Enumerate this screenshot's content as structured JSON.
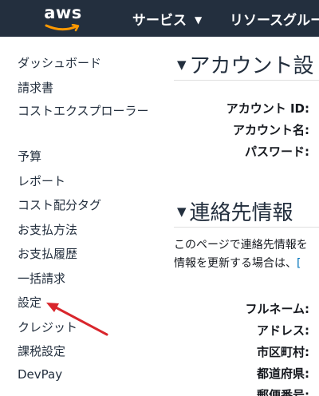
{
  "topnav": {
    "logo_text": "aws",
    "services_label": "サービス",
    "resource_groups_label": "リソースグルー"
  },
  "sidebar": {
    "items": [
      {
        "label": "ダッシュボード"
      },
      {
        "label": "請求書"
      },
      {
        "label": "コストエクスプローラー"
      },
      {
        "label": "予算"
      },
      {
        "label": "レポート"
      },
      {
        "label": "コスト配分タグ"
      },
      {
        "label": "お支払方法"
      },
      {
        "label": "お支払履歴"
      },
      {
        "label": "一括請求"
      },
      {
        "label": "設定"
      },
      {
        "label": "クレジット"
      },
      {
        "label": "課税設定"
      },
      {
        "label": "DevPay"
      }
    ]
  },
  "account_section": {
    "title": "アカウント設",
    "fields": [
      {
        "label": "アカウント ID:"
      },
      {
        "label": "アカウント名:"
      },
      {
        "label": "パスワード:"
      }
    ]
  },
  "contact_section": {
    "title": "連絡先情報",
    "desc_line1": "このページで連絡先情報を",
    "desc_line2": "情報を更新する場合は、",
    "desc_link": "[",
    "fields": [
      {
        "label": "フルネーム:"
      },
      {
        "label": "アドレス:"
      },
      {
        "label": "市区町村:"
      },
      {
        "label": "都道府県:"
      },
      {
        "label": "郵便番号:"
      }
    ]
  },
  "colors": {
    "navbar": "#232f3e",
    "logo_smile": "#ff9900",
    "annotation_arrow": "#d9262c",
    "link": "#0073bb"
  }
}
